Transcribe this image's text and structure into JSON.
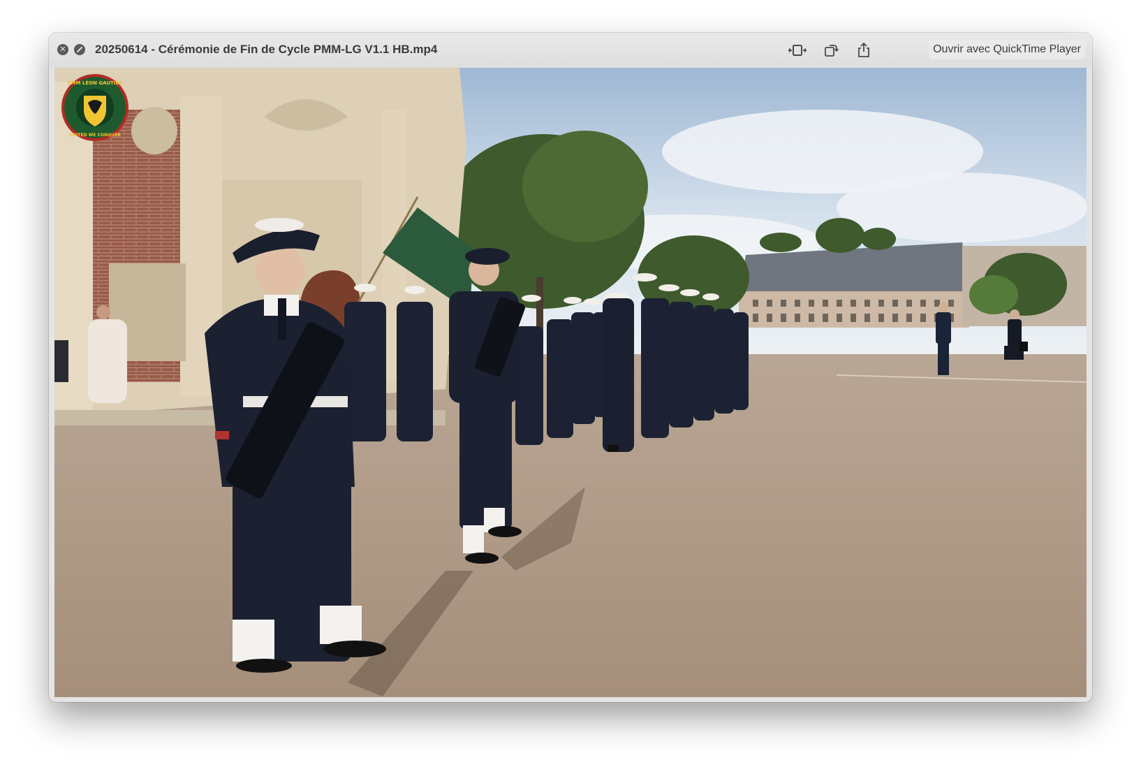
{
  "window": {
    "title": "20250614 - Cérémonie de Fin de Cycle PMM-LG V1.1 HB.mp4",
    "open_with_label": "Ouvrir avec QuickTime Player"
  },
  "toolbar": {
    "close_icon": "close-icon",
    "fullscreen_icon": "fullscreen-icon",
    "trim_icon": "trim-icon",
    "rotate_icon": "rotate-icon",
    "share_icon": "share-icon"
  },
  "video": {
    "logo_top_text": "PMM LÉON GAUTIER",
    "logo_bottom_text": "UNITED WE CONQUER"
  }
}
